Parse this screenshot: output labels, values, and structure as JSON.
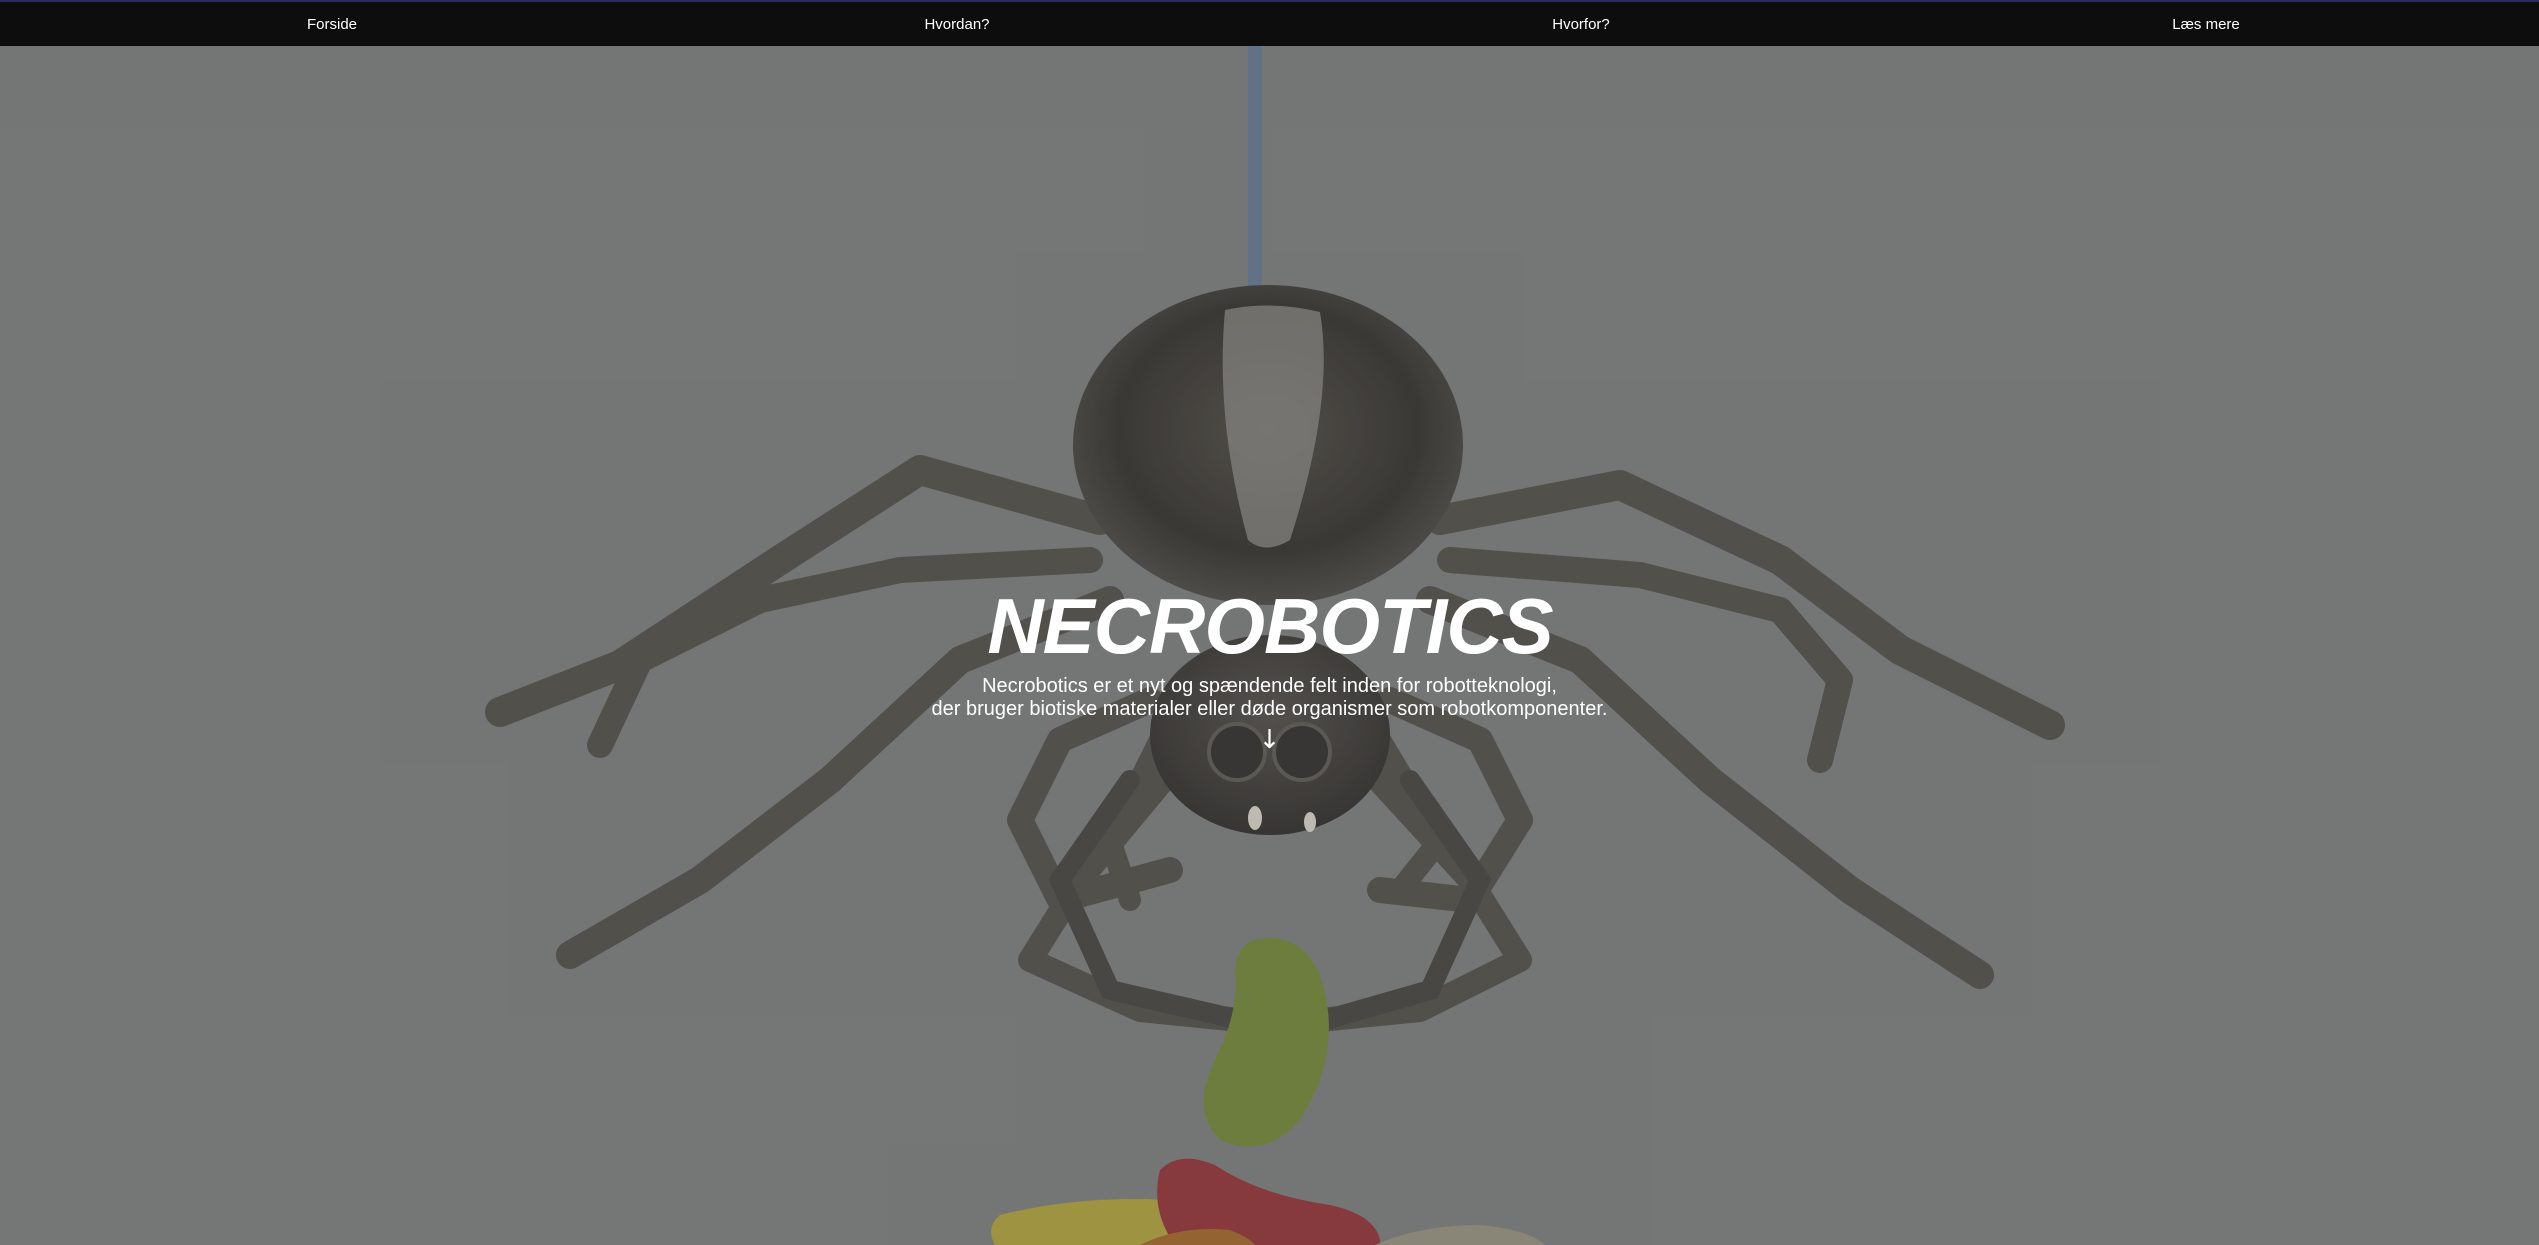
{
  "nav": {
    "items": [
      {
        "label": "Forside"
      },
      {
        "label": "Hvordan?"
      },
      {
        "label": "Hvorfor?"
      },
      {
        "label": "Læs mere"
      }
    ]
  },
  "hero": {
    "logo_text": "NECROBOTICS",
    "tagline_line1": "Necrobotics er et nyt og spændende felt inden for robotteknologi,",
    "tagline_line2": "der bruger biotiske materialer eller døde organismer som robotkomponenter.",
    "scroll_arrow": "↓"
  },
  "colors": {
    "background": "#757776",
    "nav_background": "#0d0d0d",
    "text": "#ffffff"
  }
}
